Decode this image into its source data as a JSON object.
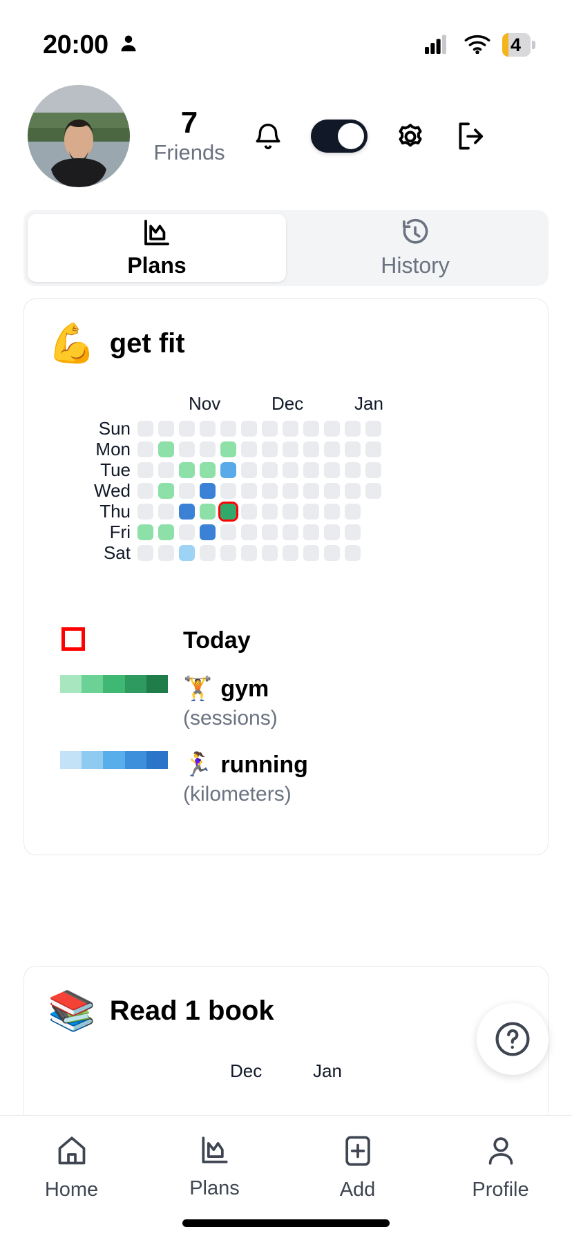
{
  "status_bar": {
    "time": "20:00",
    "person_icon": "person-icon",
    "signal_icon": "cellular-signal-icon",
    "wifi_icon": "wifi-icon",
    "battery_level": "4"
  },
  "header": {
    "avatar_alt": "user-avatar",
    "friends_count": "7",
    "friends_label": "Friends",
    "icons": [
      {
        "name": "notification-bell-icon",
        "label": "Notifications"
      },
      {
        "name": "theme-toggle",
        "label": "Toggle",
        "state": "on"
      },
      {
        "name": "settings-gear-icon",
        "label": "Settings"
      },
      {
        "name": "logout-icon",
        "label": "Log out"
      }
    ]
  },
  "tabs": [
    {
      "label": "Plans",
      "icon": "chart-plans-icon",
      "active": true
    },
    {
      "label": "History",
      "icon": "history-clock-icon",
      "active": false
    }
  ],
  "cards": [
    {
      "emoji": "💪",
      "title": "get fit",
      "legend": {
        "today_label": "Today",
        "items": [
          {
            "emoji": "🏋️",
            "name": "gym",
            "unit": "(sessions)",
            "ramp": [
              "#a8e6bf",
              "#6cd195",
              "#3fb873",
              "#2f9a5f",
              "#1f7d4c"
            ]
          },
          {
            "emoji": "🏃‍♀️",
            "name": "running",
            "unit": "(kilometers)",
            "ramp": [
              "#c3e2f8",
              "#8fcaf0",
              "#57aeea",
              "#3d8fdc",
              "#2a74c9"
            ]
          }
        ]
      }
    },
    {
      "emoji": "📚",
      "title": "Read 1 book"
    }
  ],
  "help_button": {
    "name": "help-icon",
    "label": "?"
  },
  "bottom_nav": [
    {
      "label": "Home",
      "icon": "home-icon",
      "active": false
    },
    {
      "label": "Plans",
      "icon": "chart-plans-icon",
      "active": false
    },
    {
      "label": "Add",
      "icon": "add-plus-icon",
      "active": false
    },
    {
      "label": "Profile",
      "icon": "profile-person-icon",
      "active": false
    }
  ],
  "chart_data": [
    {
      "type": "heatmap",
      "title": "get fit",
      "day_labels": [
        "Sun",
        "Mon",
        "Tue",
        "Wed",
        "Thu",
        "Fri",
        "Sat"
      ],
      "month_labels": [
        {
          "text": "Nov",
          "column": 3
        },
        {
          "text": "Dec",
          "column": 7
        },
        {
          "text": "Jan",
          "column": 11
        }
      ],
      "columns": 12,
      "colors": {
        "empty": "#eaebef",
        "gym_light": "#8ce0a8",
        "gym_dark": "#31a96b",
        "run_light": "#9dd4f5",
        "run_mid": "#5aaaea",
        "run_dark": "#3b82d6",
        "today_outline": "#ff0000"
      },
      "cells": [
        {
          "day": "Sun",
          "values": [
            "#eaebef",
            "#eaebef",
            "#eaebef",
            "#eaebef",
            "#eaebef",
            "#eaebef",
            "#eaebef",
            "#eaebef",
            "#eaebef",
            "#eaebef",
            "#eaebef",
            "#eaebef"
          ]
        },
        {
          "day": "Mon",
          "values": [
            "#eaebef",
            "#8ce0a8",
            "#eaebef",
            "#eaebef",
            "#8ce0a8",
            "#eaebef",
            "#eaebef",
            "#eaebef",
            "#eaebef",
            "#eaebef",
            "#eaebef",
            "#eaebef"
          ]
        },
        {
          "day": "Tue",
          "values": [
            "#eaebef",
            "#eaebef",
            "#8ce0a8",
            "#8ce0a8",
            "#5aaaea",
            "#eaebef",
            "#eaebef",
            "#eaebef",
            "#eaebef",
            "#eaebef",
            "#eaebef",
            "#eaebef"
          ]
        },
        {
          "day": "Wed",
          "values": [
            "#eaebef",
            "#8ce0a8",
            "#eaebef",
            "#3b82d6",
            "#eaebef",
            "#eaebef",
            "#eaebef",
            "#eaebef",
            "#eaebef",
            "#eaebef",
            "#eaebef",
            "#eaebef"
          ]
        },
        {
          "day": "Thu",
          "values": [
            "#eaebef",
            "#eaebef",
            "#3b82d6",
            "#8ce0a8",
            "#31a96b",
            "#eaebef",
            "#eaebef",
            "#eaebef",
            "#eaebef",
            "#eaebef",
            "#eaebef"
          ]
        },
        {
          "day": "Fri",
          "values": [
            "#8ce0a8",
            "#8ce0a8",
            "#eaebef",
            "#3b82d6",
            "#eaebef",
            "#eaebef",
            "#eaebef",
            "#eaebef",
            "#eaebef",
            "#eaebef",
            "#eaebef"
          ]
        },
        {
          "day": "Sat",
          "values": [
            "#eaebef",
            "#eaebef",
            "#9dd4f5",
            "#eaebef",
            "#eaebef",
            "#eaebef",
            "#eaebef",
            "#eaebef",
            "#eaebef",
            "#eaebef",
            "#eaebef"
          ]
        }
      ],
      "today_cell": {
        "day": "Thu",
        "column": 4
      }
    },
    {
      "type": "heatmap",
      "title": "Read 1 book",
      "month_labels": [
        {
          "text": "Dec",
          "column": 3
        },
        {
          "text": "Jan",
          "column": 7
        }
      ]
    }
  ]
}
